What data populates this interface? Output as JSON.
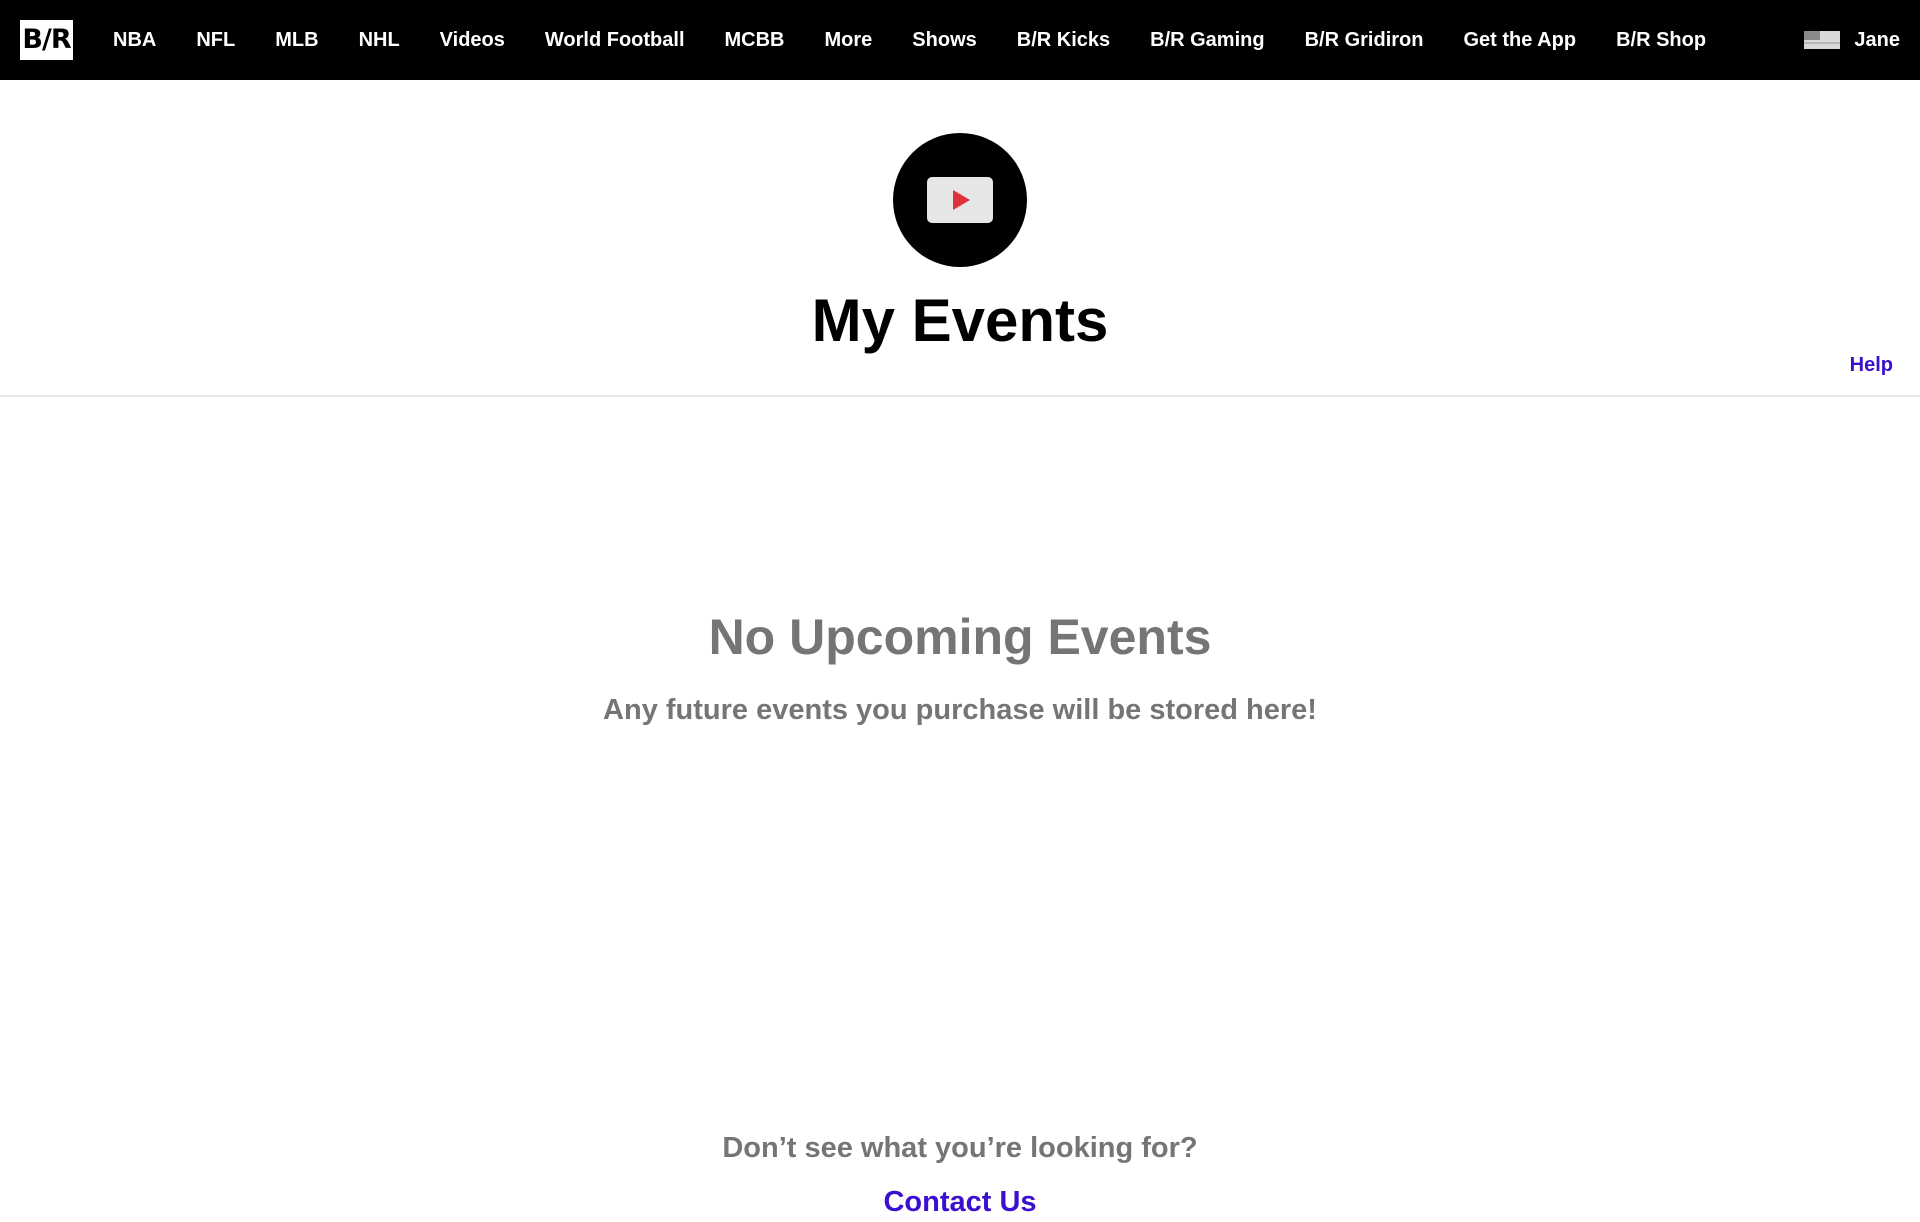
{
  "nav": {
    "logo_text": "B/R",
    "items": [
      {
        "label": "NBA"
      },
      {
        "label": "NFL"
      },
      {
        "label": "MLB"
      },
      {
        "label": "NHL"
      },
      {
        "label": "Videos"
      },
      {
        "label": "World Football"
      },
      {
        "label": "MCBB"
      },
      {
        "label": "More"
      },
      {
        "label": "Shows"
      },
      {
        "label": "B/R Kicks"
      },
      {
        "label": "B/R Gaming"
      },
      {
        "label": "B/R Gridiron"
      },
      {
        "label": "Get the App"
      },
      {
        "label": "B/R Shop"
      }
    ],
    "user_name": "Jane",
    "flag_icon": "us-flag-icon"
  },
  "header": {
    "icon": "video-play-icon",
    "title": "My Events",
    "help_label": "Help"
  },
  "empty_state": {
    "title": "No Upcoming Events",
    "subtitle": "Any future events you purchase will be stored here!"
  },
  "footer": {
    "prompt": "Don’t see what you’re looking for?",
    "link_label": "Contact Us"
  },
  "colors": {
    "nav_bg": "#000000",
    "link": "#3a0fcf",
    "muted_text": "#757575",
    "play_red": "#e0303b"
  }
}
